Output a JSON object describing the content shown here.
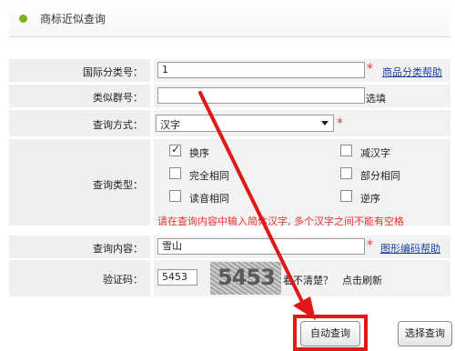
{
  "header": {
    "title": "商标近似查询"
  },
  "form": {
    "class_no": {
      "label": "国际分类号：",
      "value": "1",
      "help_link": "商品分类帮助"
    },
    "group_no": {
      "label": "类似群号：",
      "value": "",
      "suffix": "选填"
    },
    "query_mode": {
      "label": "查询方式：",
      "selected": "汉字"
    },
    "query_type": {
      "label": "查询类型：",
      "options": [
        {
          "label": "换序",
          "checked": true
        },
        {
          "label": "减汉字",
          "checked": false
        },
        {
          "label": "完全相同",
          "checked": false
        },
        {
          "label": "部分相同",
          "checked": false
        },
        {
          "label": "读音相同",
          "checked": false
        },
        {
          "label": "逆序",
          "checked": false
        }
      ],
      "warning": "请在查询内容中输入简体汉字, 多个汉字之间不能有空格"
    },
    "query_content": {
      "label": "查询内容：",
      "value": "雪山",
      "help_link": "图形编码帮助"
    },
    "captcha": {
      "label": "验证码：",
      "value": "5453",
      "image_text": "5453",
      "unclear_text": "看不清楚？",
      "refresh_text": "点击刷新"
    }
  },
  "buttons": {
    "auto_query": "自动查询",
    "select_query": "选择查询"
  },
  "required_mark": "*",
  "colors": {
    "accent": "#7ab317",
    "required": "#ee3333",
    "link": "#1a3fa0",
    "annotation": "#e01818"
  }
}
